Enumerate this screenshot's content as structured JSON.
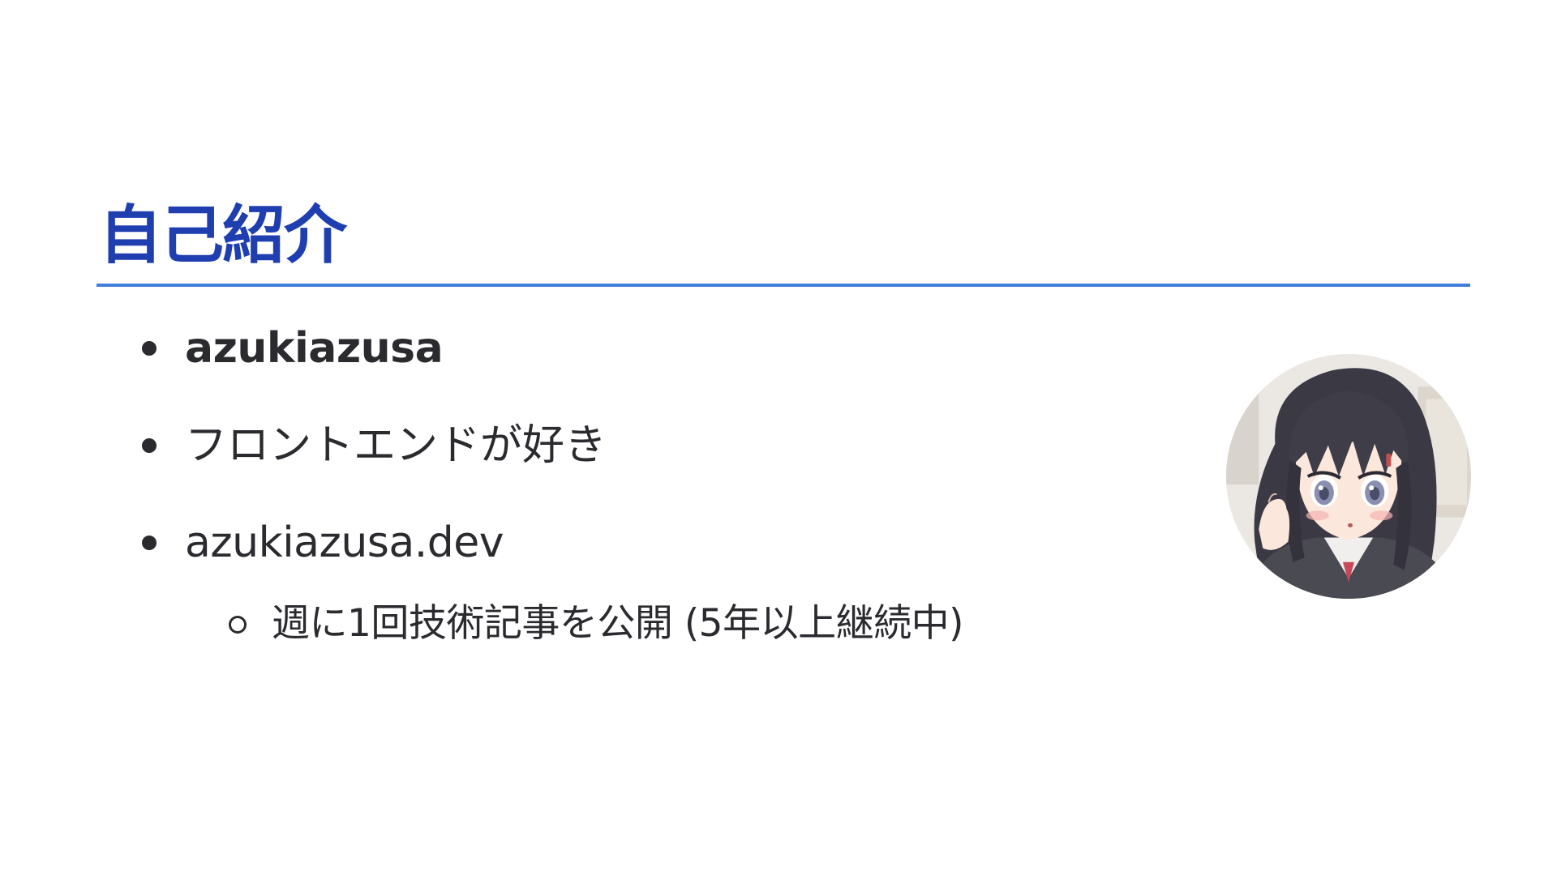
{
  "slide": {
    "title": "自己紹介",
    "items": [
      {
        "text": "azukiazusa"
      },
      {
        "text": "フロントエンドが好き"
      },
      {
        "text": "azukiazusa.dev"
      }
    ],
    "subitems": [
      {
        "text": "週に1回技術記事を公開 (5年以上継続中)"
      }
    ]
  },
  "colors": {
    "title": "#1f3fb0",
    "rule": "#3f7fd9",
    "text": "#2a2a2f",
    "background": "#ffffff"
  },
  "icons": {
    "bullet": "filled-circle-bullet",
    "sub_bullet": "hollow-circle-bullet",
    "avatar": "anime-girl-avatar"
  }
}
